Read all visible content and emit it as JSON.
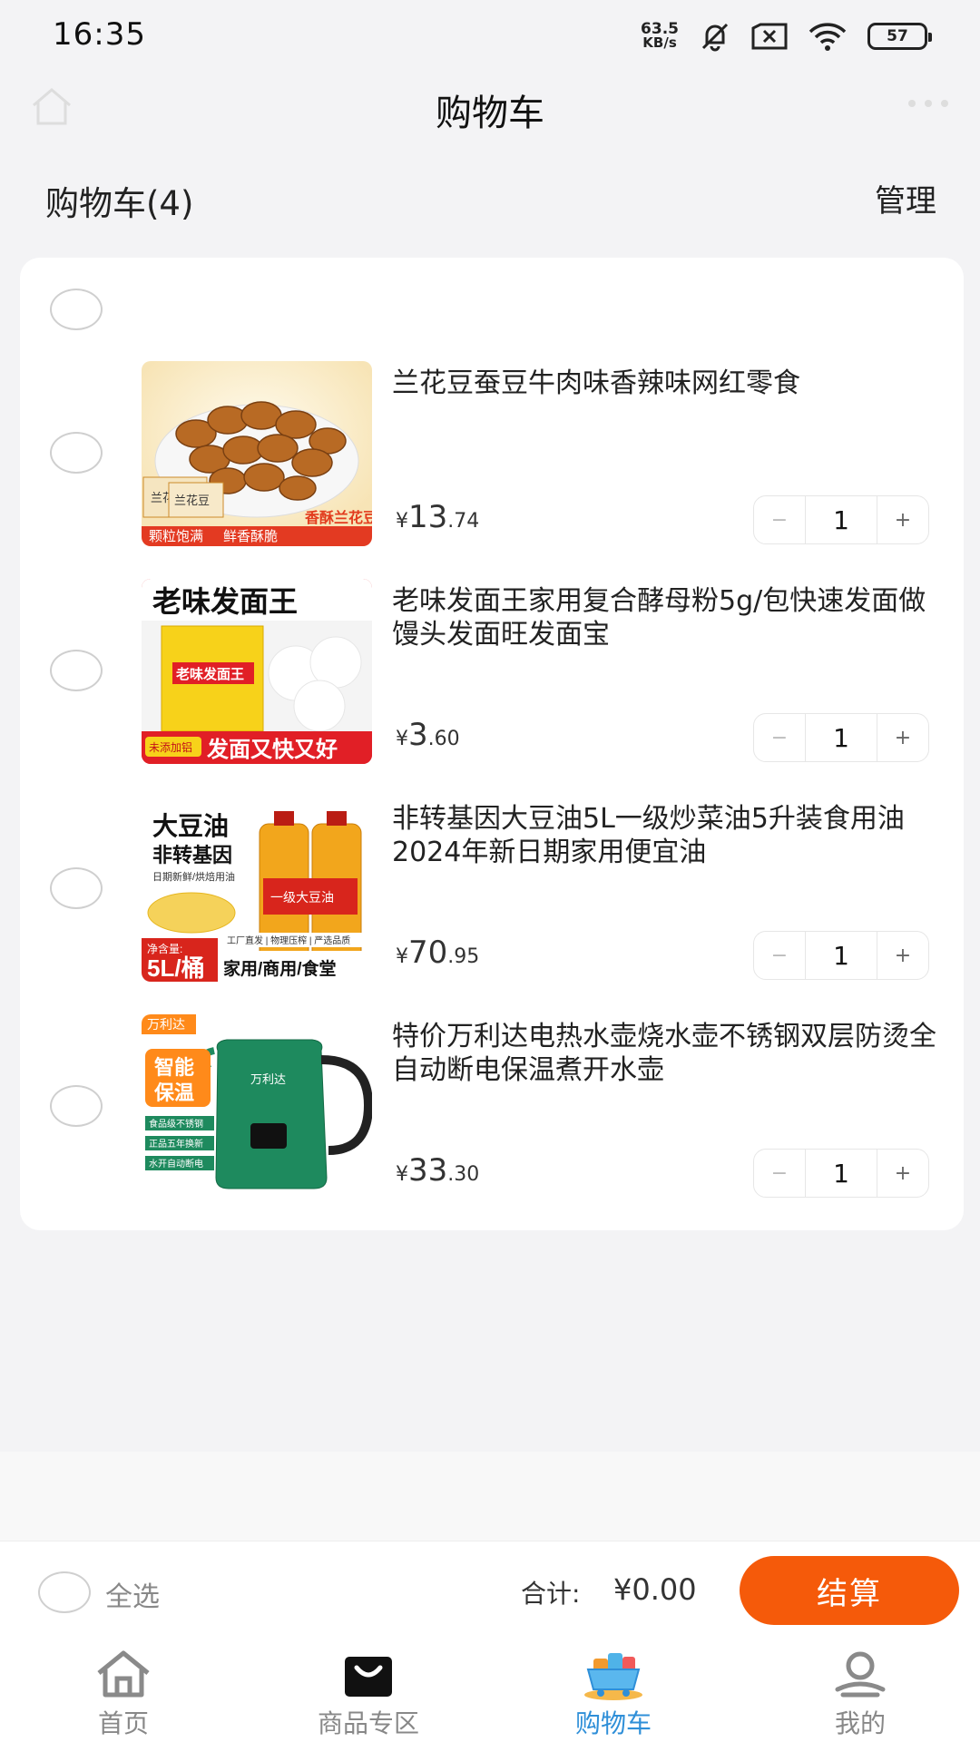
{
  "status": {
    "time": "16:35",
    "net_speed_value": "63.5",
    "net_speed_unit": "KB/s",
    "battery": "57"
  },
  "header": {
    "title": "购物车",
    "cart_count": "购物车(4)",
    "manage_label": "管理"
  },
  "items": [
    {
      "name": "兰花豆蚕豆牛肉味香辣味网红零食",
      "currency": "¥",
      "price_int": "13",
      "price_dec": ".74",
      "qty": "1",
      "minus": "−",
      "plus": "+",
      "image": {
        "badge": "香酥兰花豆",
        "tag1": "颗粒饱满",
        "tag2": "鲜香酥脆",
        "pack1": "兰花豆",
        "pack2": "兰花豆"
      }
    },
    {
      "name": "老味发面王家用复合酵母粉5g/包快速发面做馒头发面旺发面宝",
      "currency": "¥",
      "price_int": "3",
      "price_dec": ".60",
      "qty": "1",
      "minus": "−",
      "plus": "+",
      "image": {
        "title": "老味发面王",
        "pack": "老味发面王",
        "small": "未添加铝",
        "banner": "发面又快又好"
      }
    },
    {
      "name": "非转基因大豆油5L一级炒菜油5升装食用油2024年新日期家用便宜油",
      "currency": "¥",
      "price_int": "70",
      "price_dec": ".95",
      "qty": "1",
      "minus": "−",
      "plus": "+",
      "image": {
        "t1": "大豆油",
        "t2": "非转基因",
        "t3": "日期新鲜/烘焙用油",
        "bottle": "一级大豆油",
        "tags": "工厂直发 | 物理压榨 | 严选品质",
        "net": "净含量:",
        "size": "5L/桶",
        "use": "家用/商用/食堂"
      }
    },
    {
      "name": "特价万利达电热水壶烧水壶不锈钢双层防烫全自动断电保温煮开水壶",
      "currency": "¥",
      "price_int": "33",
      "price_dec": ".30",
      "qty": "1",
      "minus": "−",
      "plus": "+",
      "image": {
        "brand": "万利达",
        "feat1": "智能",
        "feat2": "保温",
        "b1": "食品级不锈钢",
        "b2": "正品五年换新",
        "b3": "水开自动断电",
        "logo": "万利达"
      }
    }
  ],
  "checkout": {
    "select_all": "全选",
    "total_label": "合计:",
    "total_value": "¥0.00",
    "pay_label": "结算"
  },
  "tabs": [
    {
      "label": "首页",
      "icon": "home-icon"
    },
    {
      "label": "商品专区",
      "icon": "shopping-bag-icon"
    },
    {
      "label": "购物车",
      "icon": "cart-icon"
    },
    {
      "label": "我的",
      "icon": "profile-icon"
    }
  ],
  "colors": {
    "accent": "#f55a0a",
    "tab_active": "#2f8fd8",
    "background": "#f3f3f5"
  }
}
